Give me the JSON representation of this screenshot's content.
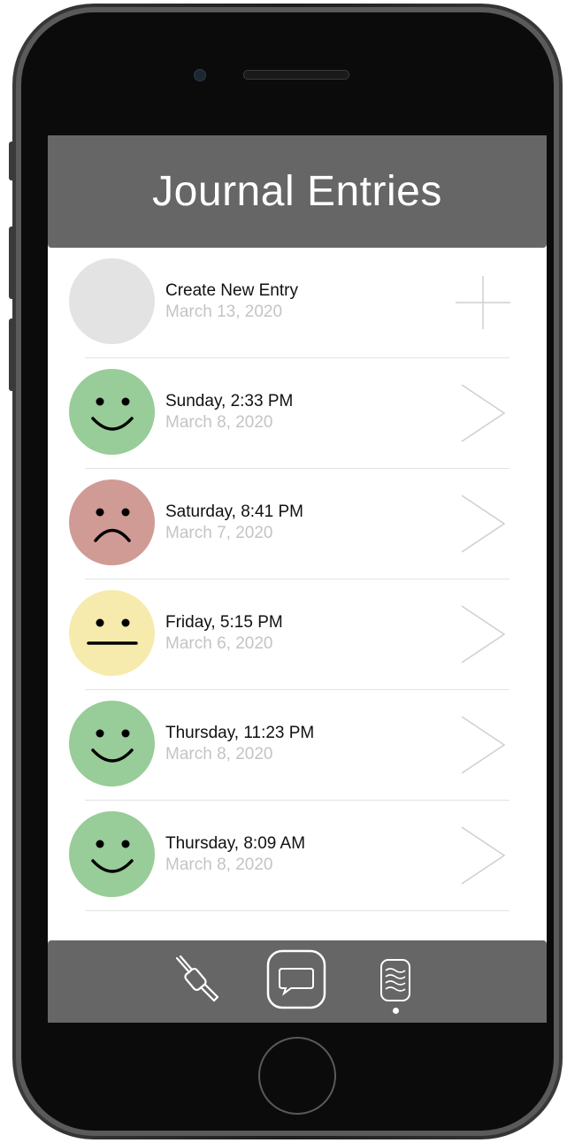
{
  "header": {
    "title": "Journal Entries"
  },
  "entries": [
    {
      "title": "Create New Entry",
      "date": "March 13, 2020",
      "mood": "none",
      "mood_color": "#e3e3e3",
      "action_icon": "plus-icon"
    },
    {
      "title": "Sunday, 2:33 PM",
      "date": "March 8, 2020",
      "mood": "happy",
      "mood_color": "#98cc98",
      "action_icon": "chevron-right-icon"
    },
    {
      "title": "Saturday, 8:41 PM",
      "date": "March 7, 2020",
      "mood": "sad",
      "mood_color": "#d09a95",
      "action_icon": "chevron-right-icon"
    },
    {
      "title": "Friday, 5:15 PM",
      "date": "March 6, 2020",
      "mood": "neutral",
      "mood_color": "#f6ebad",
      "action_icon": "chevron-right-icon"
    },
    {
      "title": "Thursday, 11:23 PM",
      "date": "March 8, 2020",
      "mood": "happy",
      "mood_color": "#98cc98",
      "action_icon": "chevron-right-icon"
    },
    {
      "title": "Thursday, 8:09 AM",
      "date": "March 8, 2020",
      "mood": "happy",
      "mood_color": "#98cc98",
      "action_icon": "chevron-right-icon"
    }
  ],
  "tabbar": {
    "tabs": [
      {
        "icon": "connector-icon"
      },
      {
        "icon": "chat-bubble-icon",
        "selected": true
      },
      {
        "icon": "phone-waves-icon"
      }
    ]
  },
  "colors": {
    "header_bg": "#666666",
    "tabbar_bg": "#666666",
    "happy": "#98cc98",
    "sad": "#d09a95",
    "neutral": "#f6ebad",
    "empty": "#e3e3e3"
  }
}
